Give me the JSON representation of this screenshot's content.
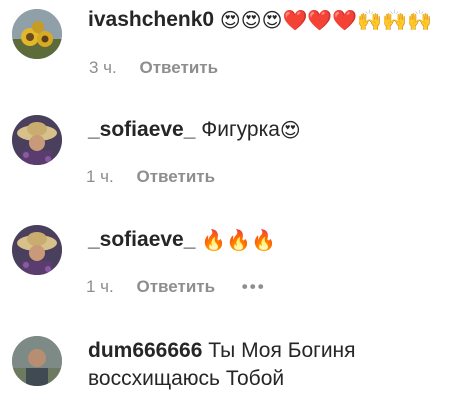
{
  "comments": [
    {
      "username": "ivashchenk0",
      "text": "",
      "emojis": "😍😍😍❤️❤️❤️🙌🙌🙌",
      "time": "3 ч.",
      "reply_label": "Ответить",
      "avatar_icon": "sunflower-avatar-icon"
    },
    {
      "username": "_sofiaeve_",
      "text": "Фигурка",
      "emojis": "😍",
      "time": "1 ч.",
      "reply_label": "Ответить",
      "avatar_icon": "straw-hat-avatar-icon"
    },
    {
      "username": "_sofiaeve_",
      "text": "",
      "emojis": "🔥🔥🔥",
      "time": "1 ч.",
      "reply_label": "Ответить",
      "more_label": "•••",
      "avatar_icon": "straw-hat-avatar-icon"
    },
    {
      "username": "dum666666",
      "text_line1": "Ты Моя Богиня",
      "text_line2": "воссхищаюсь Тобой",
      "avatar_icon": "person-avatar-icon"
    }
  ],
  "colors": {
    "text": "#262626",
    "meta": "#8e8e8e",
    "background": "#ffffff"
  }
}
